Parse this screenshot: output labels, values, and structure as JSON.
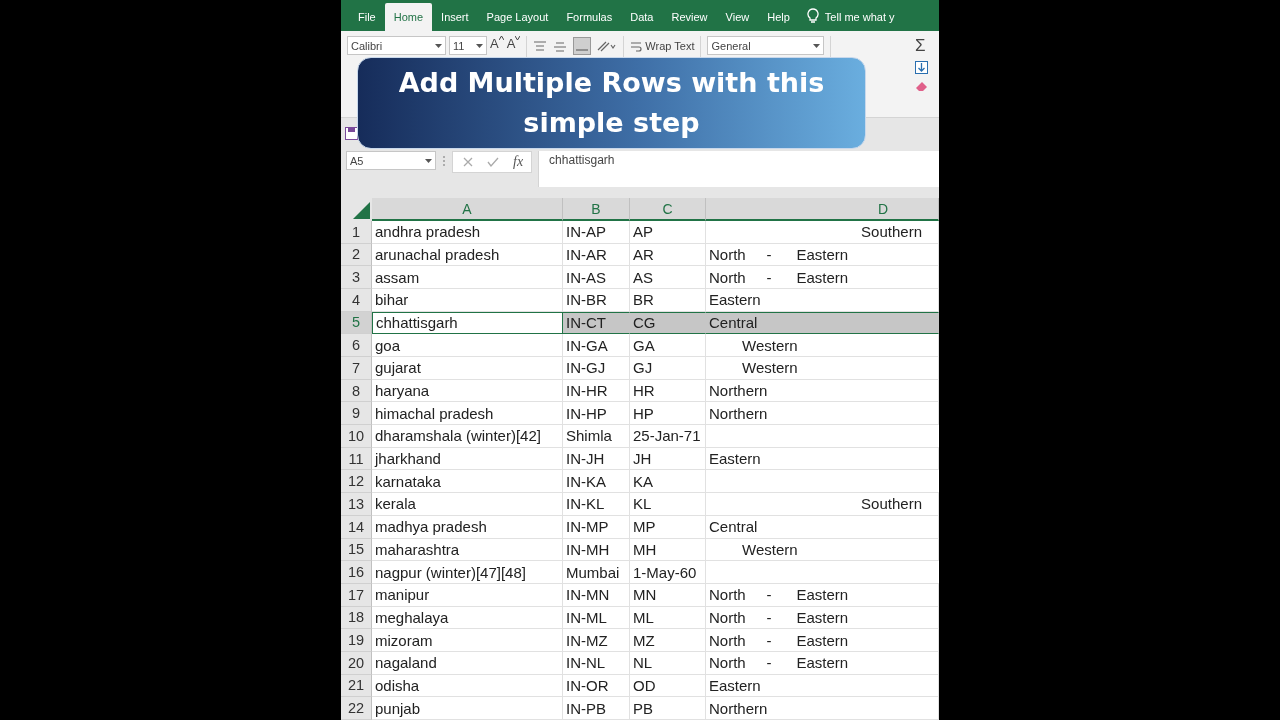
{
  "tabs": [
    {
      "label": "File",
      "selected": false
    },
    {
      "label": "Home",
      "selected": true
    },
    {
      "label": "Insert",
      "selected": false
    },
    {
      "label": "Page Layout",
      "selected": false
    },
    {
      "label": "Formulas",
      "selected": false
    },
    {
      "label": "Data",
      "selected": false
    },
    {
      "label": "Review",
      "selected": false
    },
    {
      "label": "View",
      "selected": false
    },
    {
      "label": "Help",
      "selected": false
    }
  ],
  "tell_me": "Tell me what y",
  "ribbon": {
    "font_name": "Calibri",
    "font_size": "11",
    "grow_font": "A",
    "shrink_font": "A",
    "wrap_text": "Wrap Text",
    "number_format": "General",
    "sum_icon": "Σ"
  },
  "banner": {
    "text": "Add Multiple Rows with this simple step"
  },
  "formula_bar": {
    "name_box": "A5",
    "function_label": "fx",
    "formula": "chhattisgarh"
  },
  "columns": [
    "A",
    "B",
    "C",
    "D"
  ],
  "rows": [
    {
      "number": "1",
      "cells": [
        "andhra pradesh",
        "IN-AP",
        "AP"
      ],
      "region": "Southern",
      "kind": "right",
      "selected": false
    },
    {
      "number": "2",
      "cells": [
        "arunachal pradesh",
        "IN-AR",
        "AR"
      ],
      "region": "North     -      Eastern",
      "kind": "left",
      "selected": false
    },
    {
      "number": "3",
      "cells": [
        "assam",
        "IN-AS",
        "AS"
      ],
      "region": "North     -      Eastern",
      "kind": "left",
      "selected": false
    },
    {
      "number": "4",
      "cells": [
        "bihar",
        "IN-BR",
        "BR"
      ],
      "region": "Eastern",
      "kind": "left",
      "selected": false
    },
    {
      "number": "5",
      "cells": [
        "chhattisgarh",
        "IN-CT",
        "CG"
      ],
      "region": "Central",
      "kind": "left",
      "selected": true
    },
    {
      "number": "6",
      "cells": [
        "goa",
        "IN-GA",
        "GA"
      ],
      "region": "Western",
      "kind": "indent",
      "selected": false
    },
    {
      "number": "7",
      "cells": [
        "gujarat",
        "IN-GJ",
        "GJ"
      ],
      "region": "Western",
      "kind": "indent",
      "selected": false
    },
    {
      "number": "8",
      "cells": [
        "haryana",
        "IN-HR",
        "HR"
      ],
      "region": "Northern",
      "kind": "left",
      "selected": false
    },
    {
      "number": "9",
      "cells": [
        "himachal pradesh",
        "IN-HP",
        "HP"
      ],
      "region": "Northern",
      "kind": "left",
      "selected": false
    },
    {
      "number": "10",
      "cells": [
        "dharamshala (winter)[42]",
        "Shimla",
        "25-Jan-71"
      ],
      "selected": false
    },
    {
      "number": "11",
      "cells": [
        "jharkhand",
        "IN-JH",
        "JH"
      ],
      "region": "Eastern",
      "kind": "left",
      "selected": false
    },
    {
      "number": "12",
      "cells": [
        "karnataka",
        "IN-KA",
        "KA"
      ],
      "selected": false
    },
    {
      "number": "13",
      "cells": [
        "kerala",
        "IN-KL",
        "KL"
      ],
      "region": "Southern",
      "kind": "right",
      "selected": false
    },
    {
      "number": "14",
      "cells": [
        "madhya pradesh",
        "IN-MP",
        "MP"
      ],
      "region": "Central",
      "kind": "left",
      "selected": false
    },
    {
      "number": "15",
      "cells": [
        "maharashtra",
        "IN-MH",
        "MH"
      ],
      "region": "Western",
      "kind": "indent",
      "selected": false
    },
    {
      "number": "16",
      "cells": [
        "nagpur (winter)[47][48]",
        "Mumbai",
        "1-May-60"
      ],
      "selected": false
    },
    {
      "number": "17",
      "cells": [
        "manipur",
        "IN-MN",
        "MN"
      ],
      "region": "North     -      Eastern",
      "kind": "left",
      "selected": false
    },
    {
      "number": "18",
      "cells": [
        "meghalaya",
        "IN-ML",
        "ML"
      ],
      "region": "North     -      Eastern",
      "kind": "left",
      "selected": false
    },
    {
      "number": "19",
      "cells": [
        "mizoram",
        "IN-MZ",
        "MZ"
      ],
      "region": "North     -      Eastern",
      "kind": "left",
      "selected": false
    },
    {
      "number": "20",
      "cells": [
        "nagaland",
        "IN-NL",
        "NL"
      ],
      "region": "North     -      Eastern",
      "kind": "left",
      "selected": false
    },
    {
      "number": "21",
      "cells": [
        "odisha",
        "IN-OR",
        "OD"
      ],
      "region": "Eastern",
      "kind": "left",
      "selected": false
    },
    {
      "number": "22",
      "cells": [
        "punjab",
        "IN-PB",
        "PB"
      ],
      "region": "Northern",
      "kind": "left",
      "selected": false
    }
  ]
}
